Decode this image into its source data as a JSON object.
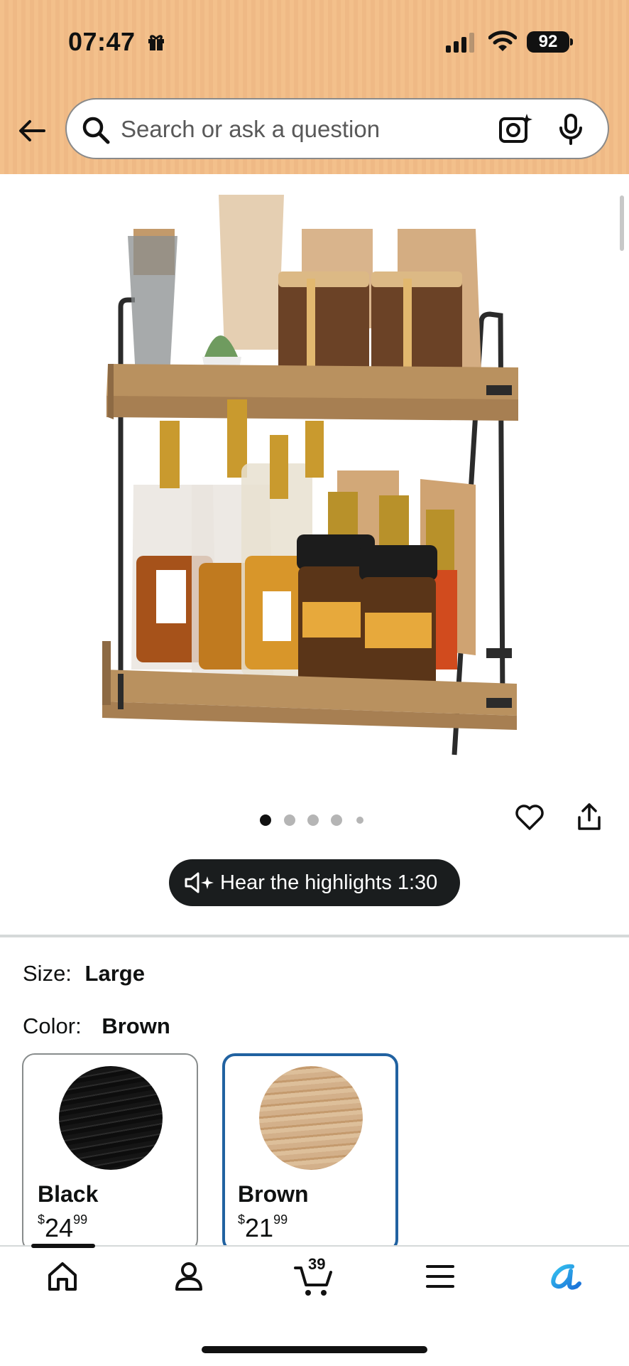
{
  "status_bar": {
    "time": "07:47",
    "battery": "92"
  },
  "search": {
    "placeholder": "Search or ask a question"
  },
  "gallery": {
    "image_count": 5,
    "active_index": 0
  },
  "audio": {
    "label": "Hear the highlights 1:30"
  },
  "options": {
    "size_label": "Size:",
    "size_value": "Large",
    "color_label": "Color:",
    "color_value": "Brown",
    "swatches": [
      {
        "name": "Black",
        "currency": "$",
        "dollars": "24",
        "cents": "99",
        "selected": false
      },
      {
        "name": "Brown",
        "currency": "$",
        "dollars": "21",
        "cents": "99",
        "selected": true
      }
    ]
  },
  "tab_bar": {
    "cart_count": "39",
    "tabs": [
      "home-icon",
      "account-icon",
      "cart-icon",
      "menu-icon",
      "rufus-icon"
    ]
  },
  "colors": {
    "header_bg": "#f3c08b",
    "selected_border": "#2162a1",
    "accent": "#1a8ee8"
  }
}
